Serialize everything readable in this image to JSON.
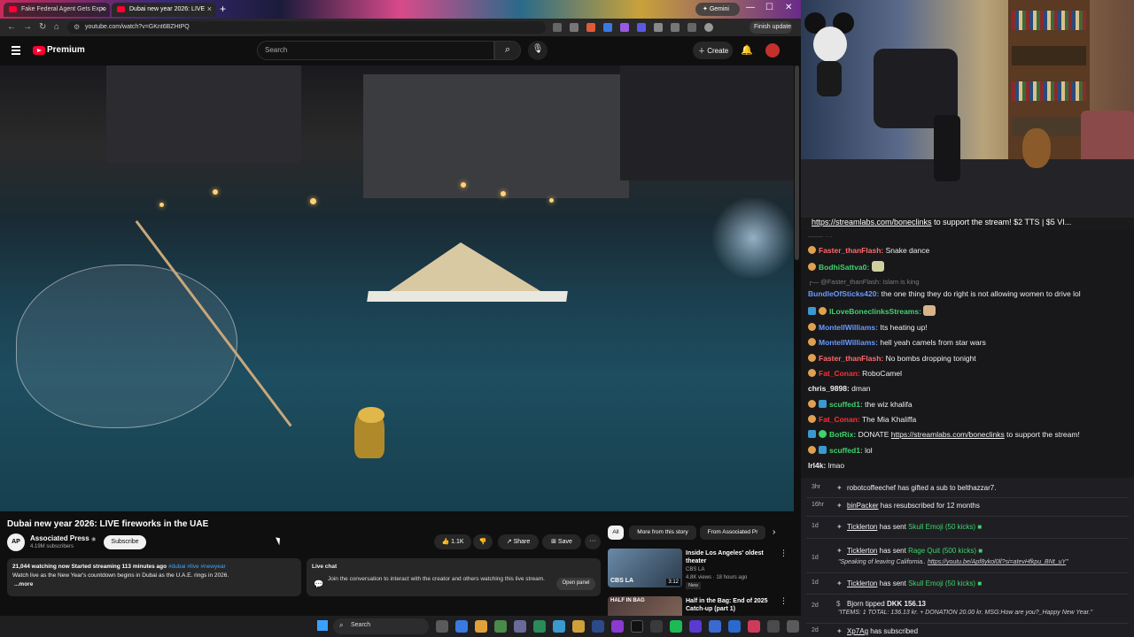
{
  "browser": {
    "tabs": [
      {
        "label": "Fake Federal Agent Gets Expo"
      },
      {
        "label": "Dubai new year 2026: LIVE"
      }
    ],
    "new_tab": "+",
    "gemini_label": "Gemini",
    "url": "youtube.com/watch?v=GKnt6BZHtPQ",
    "finish_update": "Finish update",
    "win_min": "—",
    "win_max": "☐",
    "win_close": "✕"
  },
  "youtube": {
    "logo_text": "Premium",
    "search_placeholder": "Search",
    "create_label": "Create",
    "video_title": "Dubai new year 2026: LIVE fireworks in the UAE",
    "watermark": "AP",
    "channel": {
      "avatar_text": "AP",
      "name": "Associated Press",
      "verified": "◉",
      "subscribers": "4.19M subscribers",
      "subscribe_label": "Subscribe"
    },
    "actions": {
      "likes": "1.1K",
      "share": "Share",
      "save": "Save",
      "more": "···"
    },
    "description": {
      "stats": "21,044 watching now  Started streaming 113 minutes ago",
      "tags": "#dubai #live #newyear",
      "text": "Watch live as the New Year's countdown begins in Dubai as the U.A.E. rings in 2026.",
      "more": "...more"
    },
    "live_chat": {
      "title": "Live chat",
      "text": "Join the conversation to interact with the creator and others watching this live stream.",
      "open_panel": "Open panel"
    },
    "chips": [
      "All",
      "More from this story",
      "From Associated Pr"
    ],
    "recommendations": [
      {
        "title": "Inside Los Angeles' oldest theater",
        "channel": "CBS LA",
        "meta": "4.8K views · 18 hours ago",
        "badge": "New",
        "duration": "3:12",
        "thumb_tag": "CBS LA"
      },
      {
        "title": "Half in the Bag: End of 2025 Catch-up (part 1)",
        "channel": "",
        "meta": "",
        "badge": "",
        "duration": "",
        "thumb_tag": "HALF IN BAG"
      }
    ]
  },
  "taskbar": {
    "search_label": "Search"
  },
  "stream_banner": {
    "link": "https://streamlabs.com/boneclinks",
    "text": " to support the stream! $2 TTS | $5 VI..."
  },
  "twitch_chat": [
    {
      "user": "Faster_thanFlash:",
      "text": " Snake dance",
      "color": "#ff6b6b"
    },
    {
      "user": "BodhiSattva0:",
      "text": " ",
      "color": "#3fd36b"
    },
    {
      "reply": "@Faster_thanFlash: Islam is king"
    },
    {
      "user": "BundleOfSticks420:",
      "text": " the one thing they do right is not allowing women to drive lol",
      "color": "#6a9aff"
    },
    {
      "user": "ILoveBoneclinksStreams:",
      "text": " ",
      "color": "#3fd36b"
    },
    {
      "user": "MontellWilliams:",
      "text": " Its heating up!",
      "color": "#6a9aff"
    },
    {
      "user": "MontellWilliams:",
      "text": " hell yeah camels from star wars",
      "color": "#6a9aff"
    },
    {
      "user": "Faster_thanFlash:",
      "text": " No bombs dropping tonight",
      "color": "#ff6b6b"
    },
    {
      "user": "Fat_Conan:",
      "text": " RoboCamel",
      "color": "#ff3030"
    },
    {
      "user": "chris_9898:",
      "text": " dman",
      "color": "#efeff1"
    },
    {
      "user": "scuffed1:",
      "text": " the wiz khalifa",
      "color": "#3fd36b"
    },
    {
      "user": "Fat_Conan:",
      "text": " The Mia Khaliffa",
      "color": "#ff3030"
    },
    {
      "user": "BotRix:",
      "text": " DONATE ",
      "link": "https://streamlabs.com/boneclinks",
      "tail": " to support the stream!",
      "color": "#3fd36b"
    },
    {
      "user": "scuffed1:",
      "text": " lol",
      "color": "#3fd36b"
    },
    {
      "user": "lrl4k:",
      "text": " lmao",
      "color": "#efeff1"
    }
  ],
  "events": [
    {
      "time": "3hr",
      "name": "robotcoffeechef",
      "text": " has gifted a sub to ",
      "target": "belthazzar7."
    },
    {
      "time": "16hr",
      "name": "binPacker",
      "text": " has resubscribed for 12 months"
    },
    {
      "time": "1d",
      "name": "Ticklerton",
      "text": " has sent ",
      "item": "Skull Emoji (50 kicks)"
    },
    {
      "time": "1d",
      "name": "Ticklerton",
      "text": " has sent ",
      "item": "Rage Quit (500 kicks)",
      "quote": "\"Speaking of leaving California.. ",
      "quote_link": "https://youtu.be/Apf8ykol0ll?si=atevHfkpu_BNt_uY",
      "quote_end": "\""
    },
    {
      "time": "1d",
      "name": "Ticklerton",
      "text": " has sent ",
      "item": "Skull Emoji (50 kicks)"
    },
    {
      "time": "2d",
      "name": "Bjorn",
      "text": " tipped ",
      "item": "DKK 156.13",
      "quote": "\"ITEMS: 1 TOTAL: 136.13 kr. + DONATION 20.00 kr. MSG:How are you?_Happy New Year.\""
    },
    {
      "time": "2d",
      "name": "Xp7Ag",
      "text": " has subscribed"
    }
  ]
}
